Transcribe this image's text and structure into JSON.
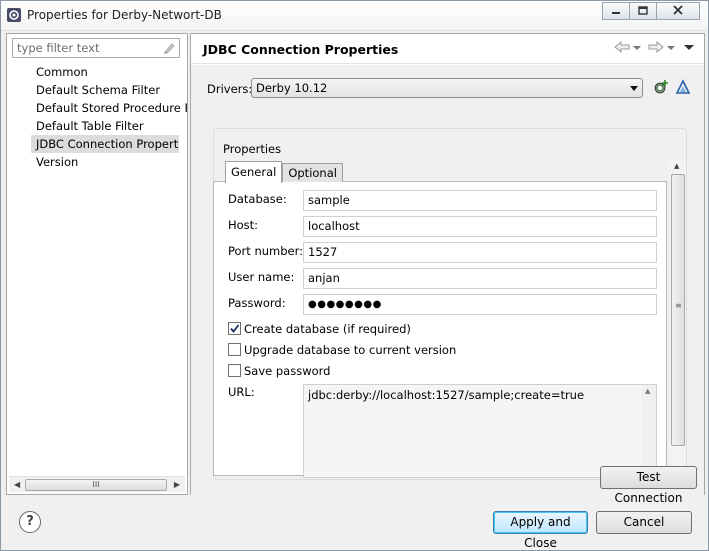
{
  "window": {
    "title": "Properties for Derby-Networt-DB",
    "controls": [
      "minimize-icon",
      "maximize-icon",
      "close-icon"
    ]
  },
  "sidebar": {
    "filter_placeholder": "type filter text",
    "items": [
      {
        "label": "Common",
        "selected": false
      },
      {
        "label": "Default Schema Filter",
        "selected": false
      },
      {
        "label": "Default Stored Procedure F",
        "selected": false
      },
      {
        "label": "Default Table Filter",
        "selected": false
      },
      {
        "label": "JDBC Connection Propertie",
        "selected": true
      },
      {
        "label": "Version",
        "selected": false
      }
    ],
    "scroll_thumb": "III"
  },
  "page": {
    "title": "JDBC Connection Properties",
    "nav_icons": [
      "back-arrow-icon",
      "dropdown-icon",
      "forward-arrow-icon",
      "dropdown-icon",
      "view-menu-icon"
    ]
  },
  "drivers": {
    "label": "Drivers:",
    "selected": "Derby 10.12",
    "icons": [
      "new-driver-icon",
      "edit-driver-icon"
    ]
  },
  "properties": {
    "group_label": "Properties",
    "tabs": [
      {
        "label": "General",
        "active": true
      },
      {
        "label": "Optional",
        "active": false
      }
    ],
    "fields": [
      {
        "label": "Database:",
        "value": "sample"
      },
      {
        "label": "Host:",
        "value": "localhost"
      },
      {
        "label": "Port number:",
        "value": "1527"
      },
      {
        "label": "User name:",
        "value": "anjan"
      },
      {
        "label": "Password:",
        "value": "●●●●●●●●"
      }
    ],
    "checkboxes": [
      {
        "label": "Create database (if required)",
        "checked": true
      },
      {
        "label": "Upgrade database to current version",
        "checked": false
      },
      {
        "label": "Save password",
        "checked": false
      }
    ],
    "url_label": "URL:",
    "url_value": "jdbc:derby://localhost:1527/sample;create=true"
  },
  "buttons": {
    "test_connection": "Test Connection",
    "apply_close": "Apply and Close",
    "cancel": "Cancel",
    "help": "?"
  }
}
